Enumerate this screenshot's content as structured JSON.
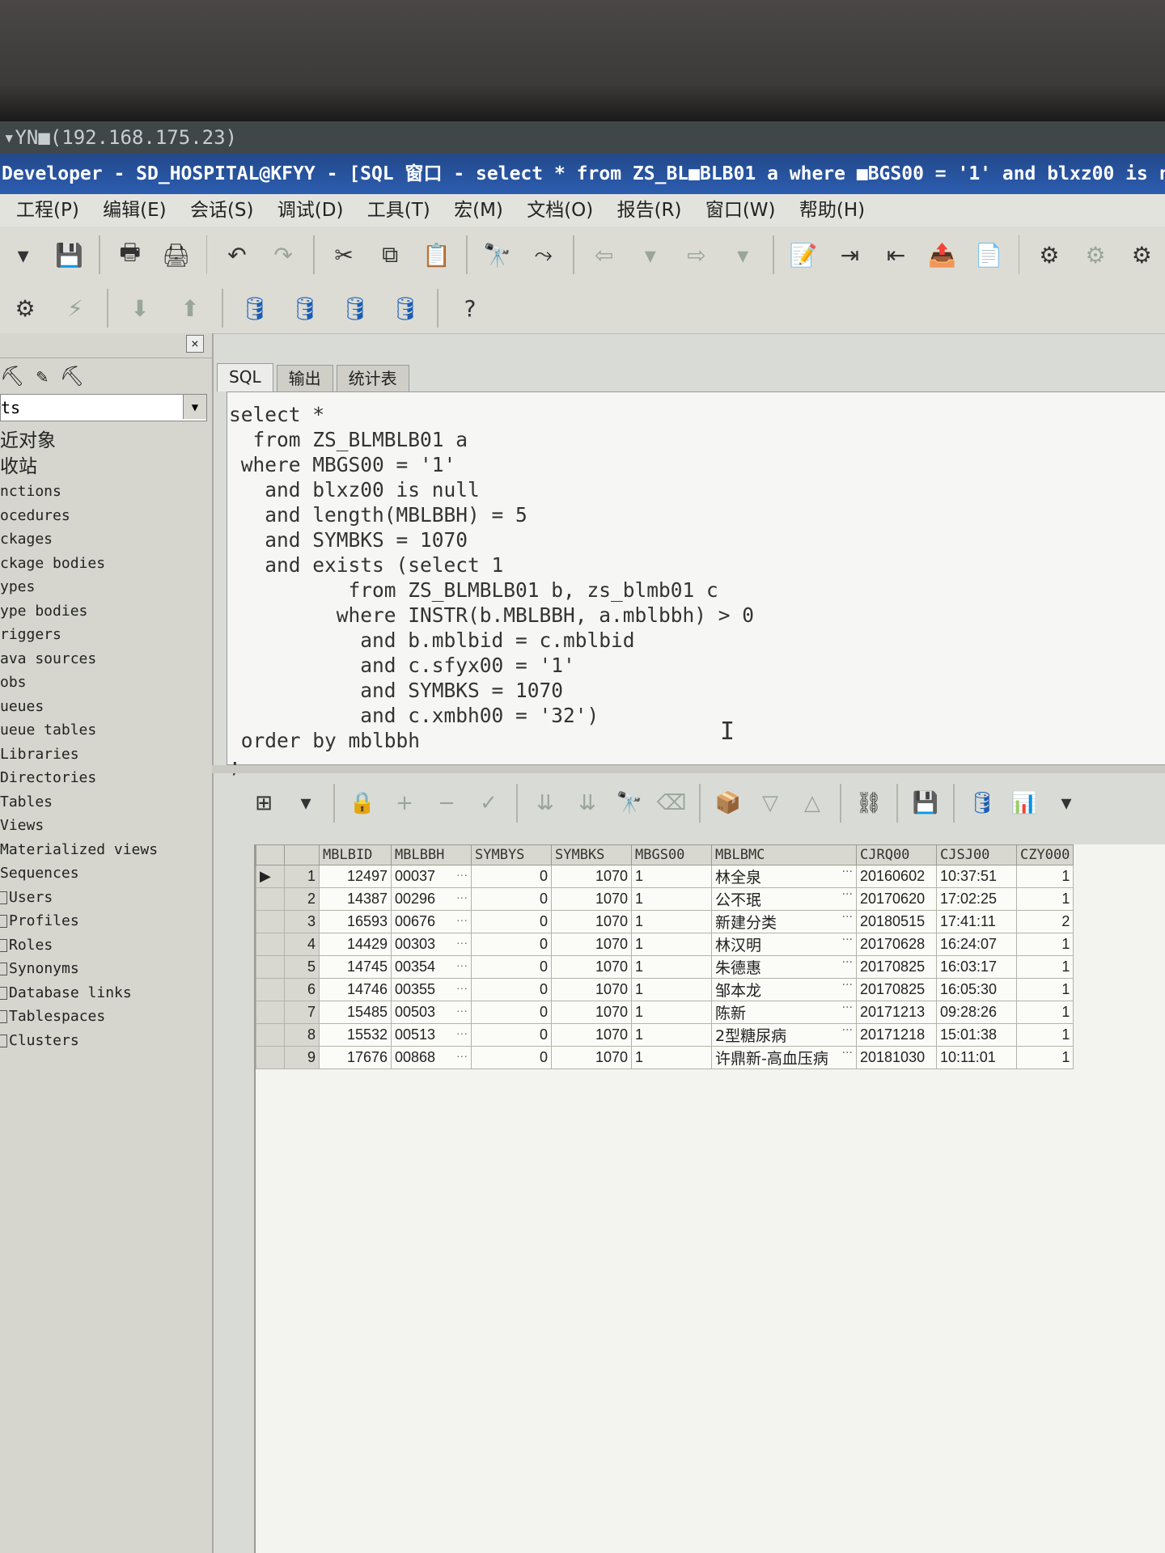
{
  "window": {
    "remote_title": "▾YN■(192.168.175.23)",
    "title": "Developer - SD_HOSPITAL@KFYY - [SQL 窗口 - select * from ZS_BL■BLB01 a where ■BGS00 = '1' and blxz00 is n"
  },
  "menu": [
    "工程(P)",
    "编辑(E)",
    "会话(S)",
    "调试(D)",
    "工具(T)",
    "宏(M)",
    "文档(O)",
    "报告(R)",
    "窗口(W)",
    "帮助(H)"
  ],
  "toolbar_main": [
    {
      "name": "dropdown-arrow-icon",
      "glyph": "▾"
    },
    {
      "name": "save-icon",
      "glyph": "💾"
    },
    {
      "sep": true
    },
    {
      "name": "print-icon",
      "glyph": "🖶"
    },
    {
      "name": "print-preview-icon",
      "glyph": "🖨"
    },
    {
      "sep": true
    },
    {
      "name": "undo-icon",
      "glyph": "↶"
    },
    {
      "name": "redo-icon",
      "glyph": "↷",
      "dim": true
    },
    {
      "sep": true
    },
    {
      "name": "cut-icon",
      "glyph": "✂"
    },
    {
      "name": "copy-icon",
      "glyph": "⧉"
    },
    {
      "name": "paste-icon",
      "glyph": "📋"
    },
    {
      "sep": true
    },
    {
      "name": "find-icon",
      "glyph": "🔭"
    },
    {
      "name": "find-next-icon",
      "glyph": "⤳"
    },
    {
      "sep": true
    },
    {
      "name": "back-icon",
      "glyph": "⇦",
      "dim": true
    },
    {
      "name": "back-dropdown-icon",
      "glyph": "▾",
      "dim": true
    },
    {
      "name": "forward-icon",
      "glyph": "⇨",
      "dim": true
    },
    {
      "name": "forward-dropdown-icon",
      "glyph": "▾",
      "dim": true
    },
    {
      "sep": true
    },
    {
      "name": "format-icon",
      "glyph": "📝"
    },
    {
      "name": "indent-icon",
      "glyph": "⇥"
    },
    {
      "name": "unindent-icon",
      "glyph": "⇤"
    },
    {
      "name": "export-icon",
      "glyph": "📤",
      "red": true
    },
    {
      "name": "import-icon",
      "glyph": "📄",
      "red": true
    },
    {
      "sep": true
    },
    {
      "name": "break-icon",
      "glyph": "⚙"
    },
    {
      "name": "step-icon",
      "glyph": "⚙",
      "dim": true
    },
    {
      "name": "trace-icon",
      "glyph": "⚙"
    }
  ],
  "toolbar_second": [
    {
      "name": "execute-gear-icon",
      "glyph": "⚙"
    },
    {
      "name": "stop-icon",
      "glyph": "⚡",
      "dim": true
    },
    {
      "sep": true
    },
    {
      "name": "commit-icon",
      "glyph": "⬇",
      "dim": true
    },
    {
      "name": "rollback-icon",
      "glyph": "⬆",
      "dim": true
    },
    {
      "sep": true
    },
    {
      "name": "db-explain-icon",
      "glyph": "🛢",
      "blue": true
    },
    {
      "name": "db-sql-icon",
      "glyph": "🛢",
      "blue": true
    },
    {
      "name": "db-connect-icon",
      "glyph": "🛢",
      "blue": true
    },
    {
      "name": "db-refresh-icon",
      "glyph": "🛢",
      "blue": true
    },
    {
      "sep": true
    },
    {
      "name": "help-icon",
      "glyph": "?"
    }
  ],
  "browser": {
    "icons": "⛏ ✎ ⛏",
    "combo_value": "ts",
    "items": [
      "近对象",
      "收站",
      "nctions",
      "ocedures",
      "ckages",
      "ckage bodies",
      "ypes",
      "ype bodies",
      "riggers",
      "ava sources",
      "obs",
      "ueues",
      "ueue tables",
      "Libraries",
      "Directories",
      "Tables",
      "Views",
      "Materialized views",
      "Sequences",
      "Users",
      "Profiles",
      "Roles",
      "Synonyms",
      "Database links",
      "Tablespaces",
      "Clusters"
    ]
  },
  "tabs": [
    "SQL",
    "输出",
    "统计表"
  ],
  "sql_lines": [
    "select *",
    "  from ZS_BLMBLB01 a",
    " where MBGS00 = '1'",
    "   and blxz00 is null",
    "   and length(MBLBBH) = 5",
    "   and SYMBKS = 1070",
    "   and exists (select 1",
    "          from ZS_BLMBLB01 b, zs_blmb01 c",
    "         where INSTR(b.MBLBBH, a.mblbbh) > 0",
    "           and b.mblbid = c.mblbid",
    "           and c.sfyx00 = '1'",
    "           and SYMBKS = 1070",
    "           and c.xmbh00 = '32')",
    " order by mblbbh",
    ";"
  ],
  "results_toolbar": [
    {
      "name": "grid-layout-icon",
      "glyph": "⊞"
    },
    {
      "name": "grid-dropdown-icon",
      "glyph": "▾"
    },
    {
      "sep": true
    },
    {
      "name": "lock-icon",
      "glyph": "🔒"
    },
    {
      "name": "insert-record-icon",
      "glyph": "+",
      "dim": true
    },
    {
      "name": "delete-record-icon",
      "glyph": "−",
      "dim": true
    },
    {
      "name": "post-record-icon",
      "glyph": "✓",
      "dim": true
    },
    {
      "sep": true
    },
    {
      "name": "fetch-next-icon",
      "glyph": "⇊",
      "dim": true
    },
    {
      "name": "fetch-all-icon",
      "glyph": "⇊",
      "dim": true
    },
    {
      "name": "find-icon",
      "glyph": "🔭"
    },
    {
      "name": "clear-icon",
      "glyph": "⌫",
      "dim": true
    },
    {
      "sep": true
    },
    {
      "name": "export-results-icon",
      "glyph": "📦"
    },
    {
      "name": "next-icon",
      "glyph": "▽",
      "dim": true
    },
    {
      "name": "prev-icon",
      "glyph": "△",
      "dim": true
    },
    {
      "sep": true
    },
    {
      "name": "query-tree-icon",
      "glyph": "⛓"
    },
    {
      "sep": true
    },
    {
      "name": "save-results-icon",
      "glyph": "💾"
    },
    {
      "sep": true
    },
    {
      "name": "database-icon",
      "glyph": "🛢",
      "blue": true
    },
    {
      "name": "chart-icon",
      "glyph": "📊"
    },
    {
      "name": "chart-dropdown-icon",
      "glyph": "▾"
    }
  ],
  "grid": {
    "columns": [
      "MBLBID",
      "MBLBBH",
      "SYMBYS",
      "SYMBKS",
      "MBGS00",
      "MBLBMC",
      "CJRQ00",
      "CJSJ00",
      "CZY000"
    ],
    "rows": [
      {
        "n": "1",
        "id": "12497",
        "bh": "00037",
        "ys": "0",
        "ks": "1070",
        "gs": "1",
        "mc": "林全泉",
        "rq": "20160602",
        "sj": "10:37:51",
        "czy": "1"
      },
      {
        "n": "2",
        "id": "14387",
        "bh": "00296",
        "ys": "0",
        "ks": "1070",
        "gs": "1",
        "mc": "公不珉",
        "rq": "20170620",
        "sj": "17:02:25",
        "czy": "1"
      },
      {
        "n": "3",
        "id": "16593",
        "bh": "00676",
        "ys": "0",
        "ks": "1070",
        "gs": "1",
        "mc": "新建分类",
        "rq": "20180515",
        "sj": "17:41:11",
        "czy": "2"
      },
      {
        "n": "4",
        "id": "14429",
        "bh": "00303",
        "ys": "0",
        "ks": "1070",
        "gs": "1",
        "mc": "林汉明",
        "rq": "20170628",
        "sj": "16:24:07",
        "czy": "1"
      },
      {
        "n": "5",
        "id": "14745",
        "bh": "00354",
        "ys": "0",
        "ks": "1070",
        "gs": "1",
        "mc": "朱德惠",
        "rq": "20170825",
        "sj": "16:03:17",
        "czy": "1"
      },
      {
        "n": "6",
        "id": "14746",
        "bh": "00355",
        "ys": "0",
        "ks": "1070",
        "gs": "1",
        "mc": "邹本龙",
        "rq": "20170825",
        "sj": "16:05:30",
        "czy": "1"
      },
      {
        "n": "7",
        "id": "15485",
        "bh": "00503",
        "ys": "0",
        "ks": "1070",
        "gs": "1",
        "mc": "陈新",
        "rq": "20171213",
        "sj": "09:28:26",
        "czy": "1"
      },
      {
        "n": "8",
        "id": "15532",
        "bh": "00513",
        "ys": "0",
        "ks": "1070",
        "gs": "1",
        "mc": "2型糖尿病",
        "rq": "20171218",
        "sj": "15:01:38",
        "czy": "1"
      },
      {
        "n": "9",
        "id": "17676",
        "bh": "00868",
        "ys": "0",
        "ks": "1070",
        "gs": "1",
        "mc": "许鼎新-高血压病",
        "rq": "20181030",
        "sj": "10:11:01",
        "czy": "1"
      }
    ]
  }
}
